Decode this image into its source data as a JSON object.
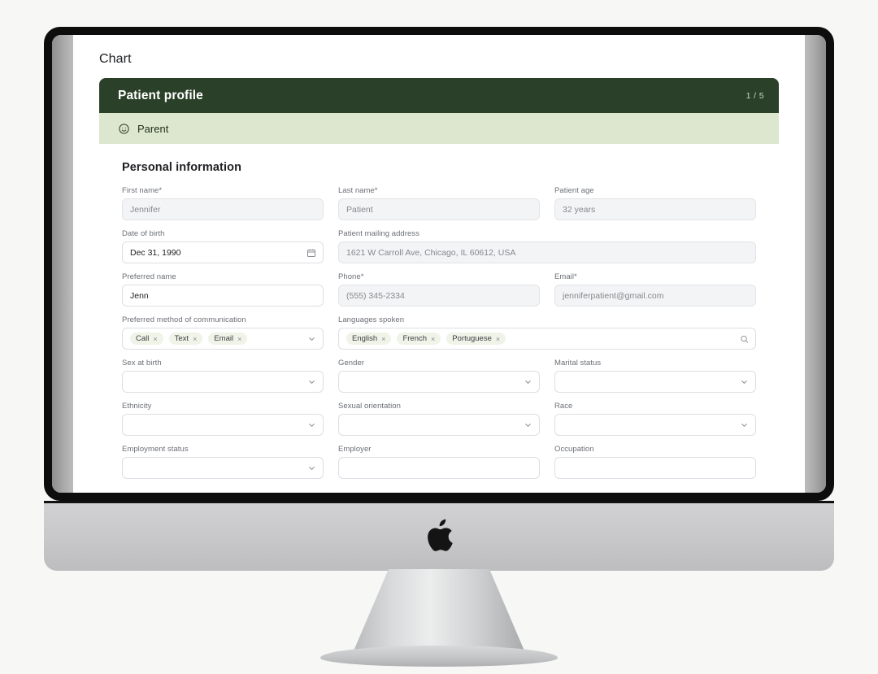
{
  "app": {
    "page_title": "Chart"
  },
  "card": {
    "title": "Patient profile",
    "step_counter": "1 / 5",
    "subject": {
      "icon": "smiley-face-icon",
      "label": "Parent"
    },
    "section_title": "Personal information"
  },
  "fields": {
    "first_name": {
      "label": "First name*",
      "value": "Jennifer"
    },
    "last_name": {
      "label": "Last name*",
      "value": "Patient"
    },
    "patient_age": {
      "label": "Patient age",
      "value": "32 years"
    },
    "date_of_birth": {
      "label": "Date of birth",
      "value": "Dec 31, 1990",
      "icon": "calendar-icon"
    },
    "mailing_address": {
      "label": "Patient mailing address",
      "value": "1621 W Carroll Ave, Chicago, IL 60612, USA"
    },
    "preferred_name": {
      "label": "Preferred name",
      "value": "Jenn"
    },
    "phone": {
      "label": "Phone*",
      "value": "(555) 345-2334"
    },
    "email": {
      "label": "Email*",
      "value": "jenniferpatient@gmail.com"
    },
    "preferred_communication": {
      "label": "Preferred method of communication",
      "chips": [
        "Call",
        "Text",
        "Email"
      ],
      "icon": "chevron-down-icon"
    },
    "languages_spoken": {
      "label": "Languages spoken",
      "chips": [
        "English",
        "French",
        "Portuguese"
      ],
      "icon": "search-icon"
    },
    "sex_at_birth": {
      "label": "Sex at birth",
      "value": ""
    },
    "gender": {
      "label": "Gender",
      "value": ""
    },
    "marital_status": {
      "label": "Marital status",
      "value": ""
    },
    "ethnicity": {
      "label": "Ethnicity",
      "value": ""
    },
    "sexual_orientation": {
      "label": "Sexual orientation",
      "value": ""
    },
    "race": {
      "label": "Race",
      "value": ""
    },
    "employment_status": {
      "label": "Employment status",
      "value": ""
    },
    "employer": {
      "label": "Employer",
      "value": ""
    },
    "occupation": {
      "label": "Occupation",
      "value": ""
    }
  },
  "chip_remove_label": "×",
  "colors": {
    "header_green": "#2b4028",
    "subject_sage": "#dde6ce",
    "chip_bg": "#f0f3e8",
    "page_bg": "#f7f7f5"
  }
}
